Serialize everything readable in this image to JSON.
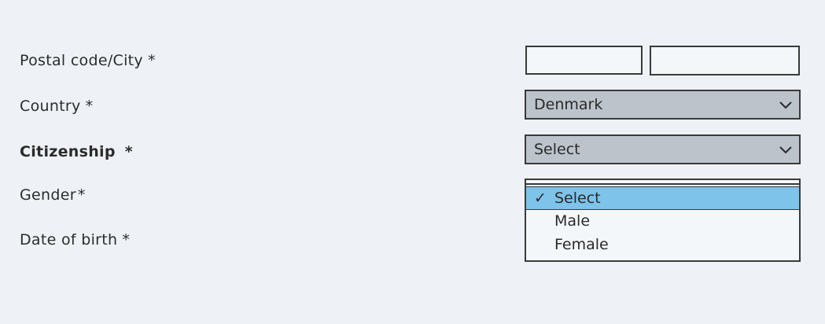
{
  "form": {
    "labels": {
      "postal_city": "Postal code/City",
      "country": "Country",
      "citizenship": "Citizenship",
      "gender": "Gender",
      "dob": "Date of birth"
    },
    "required_mark": "*",
    "country": {
      "value": "Denmark"
    },
    "citizenship": {
      "value": "Select"
    },
    "gender": {
      "options": [
        "Select",
        "Male",
        "Female"
      ],
      "selected_index": 0,
      "check_mark": "✓"
    }
  },
  "colors": {
    "background": "#eef2f6",
    "select_fill": "#bcc3cb",
    "highlight": "#7ec3ea",
    "border": "#3a3a3a"
  },
  "icons": {
    "select_arrow": "chevron-down-icon",
    "checked": "check-icon"
  }
}
